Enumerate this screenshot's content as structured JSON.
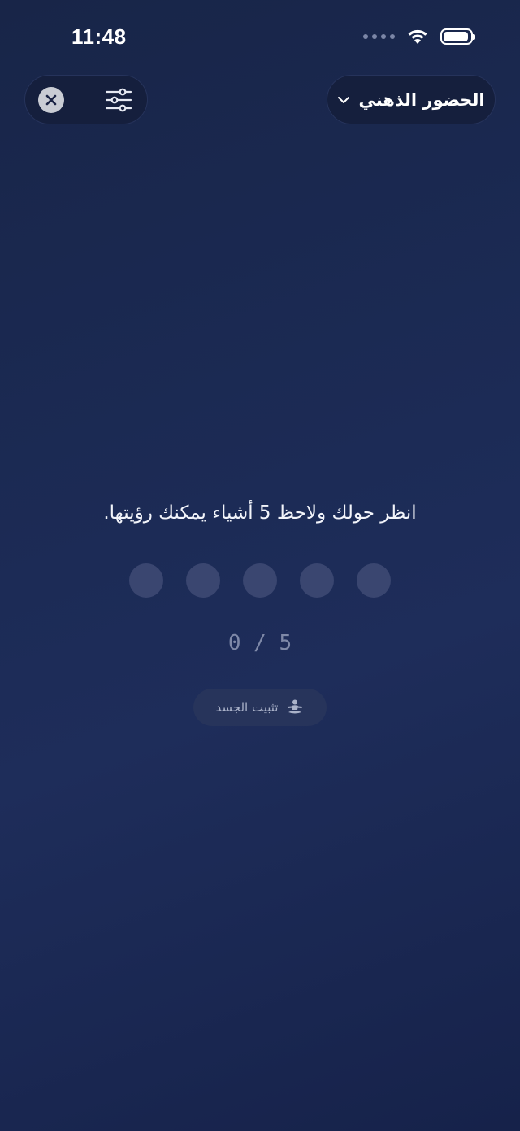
{
  "status_bar": {
    "time": "11:48"
  },
  "header": {
    "mode_label": "الحضور الذهني",
    "icons": {
      "close": "close-icon",
      "settings": "sliders-icon",
      "dropdown": "chevron-down-icon"
    }
  },
  "exercise": {
    "instruction": "انظر حولك ولاحظ 5 أشياء يمكنك رؤيتها.",
    "progress": {
      "current": 0,
      "total": 5,
      "label": "0 / 5"
    },
    "chip_label": "تثبيت الجسد",
    "chip_icon": "meditation-icon"
  },
  "colors": {
    "background": "#1c2b56",
    "dot": "#3a4670",
    "chip": "#27345b"
  }
}
